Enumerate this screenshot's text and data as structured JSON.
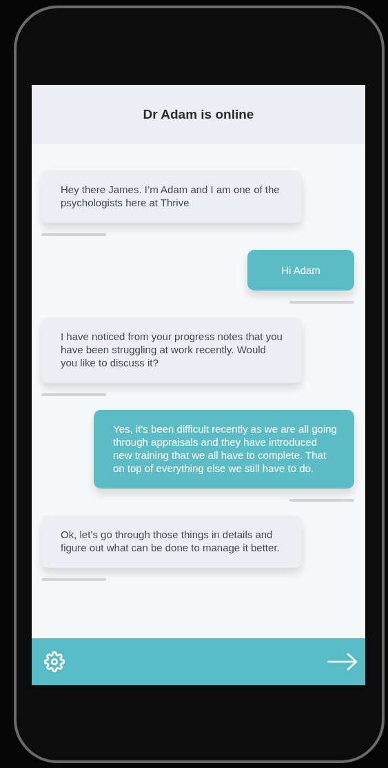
{
  "header": {
    "title": "Dr Adam is online"
  },
  "messages": [
    {
      "kind": "doctor",
      "text": "Hey there James. I’m Adam and I am one of the psychologists here at Thrive"
    },
    {
      "kind": "user",
      "text": "Hi Adam"
    },
    {
      "kind": "doctor",
      "text": "I have noticed from your progress notes that you have been struggling at work recently. Would you like to discuss it?"
    },
    {
      "kind": "user",
      "text": "Yes, it’s been difficult recently as we are all going through appraisals and they have introduced new training that we all have to complete. That on top of everything else we still have to do."
    },
    {
      "kind": "doctor",
      "text": "Ok, let’s go through those things in details and figure out what can be done to manage it better."
    }
  ]
}
